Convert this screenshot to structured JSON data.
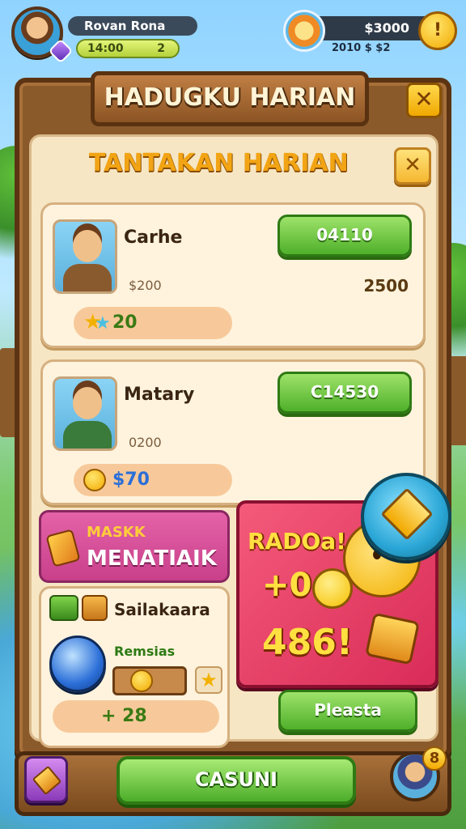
{
  "hud": {
    "player_name": "Rovan Rona",
    "xp_value": "14:00",
    "level": "2",
    "coins": "$3000",
    "coin_sub": "2010 $ $2",
    "coin_button": "!"
  },
  "window": {
    "title": "HADUGKU HARIAN",
    "close_label": "✕",
    "section_title": "TANTAKAN HARIAN",
    "section_close_label": "✕"
  },
  "cards": [
    {
      "name": "Carhe",
      "button": "04110",
      "sub": "$200",
      "right_value": "2500",
      "reward": "20"
    },
    {
      "name": "Matary",
      "button": "C14530",
      "sub": "0200",
      "reward": "$70"
    }
  ],
  "mask_panel": {
    "line1": "MASKK",
    "line2": "MENATIAIK"
  },
  "sub_panel": {
    "title": "Sailakaara",
    "label": "Remsias",
    "reward": "+ 28"
  },
  "promo": {
    "line1": "RADOa!",
    "line2": "+0",
    "line3": "486!",
    "button": "Pleasta"
  },
  "bottom": {
    "main_button": "CASUNI",
    "friend_badge": "8"
  },
  "colors": {
    "wood": "#8b5a2b",
    "parchment": "#f6e6c4",
    "green_button": "#4fb02a",
    "promo": "#d92c58",
    "gold": "#f2a900"
  }
}
